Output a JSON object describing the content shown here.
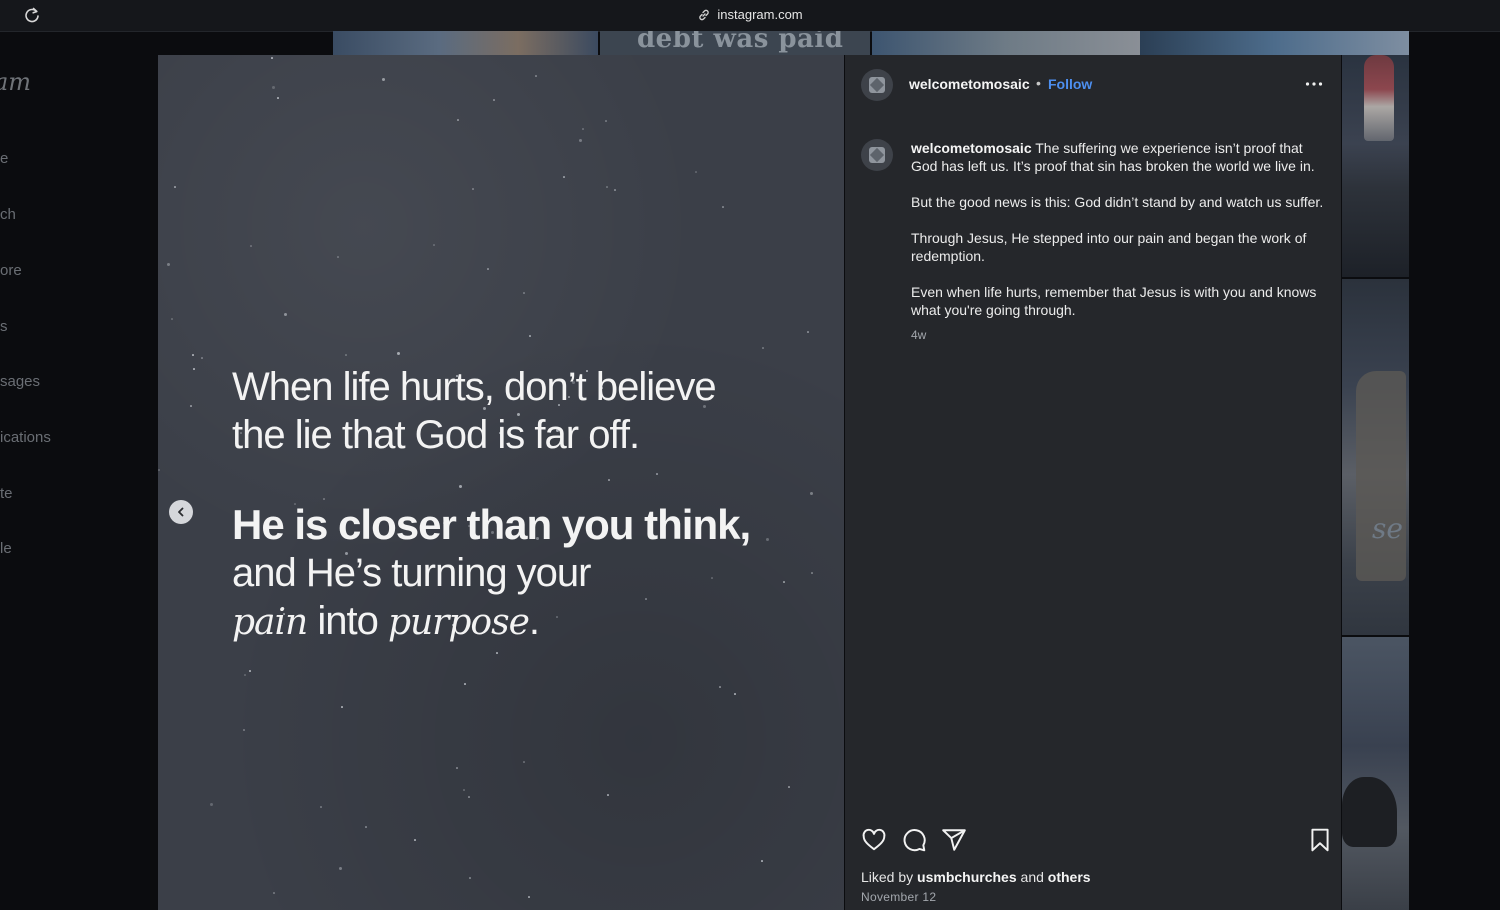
{
  "browser": {
    "url": "instagram.com"
  },
  "background_page": {
    "logo_fragment": "am",
    "nav_fragments": [
      "e",
      "ch",
      "ore",
      "s",
      "sages",
      "ications",
      "te",
      "le"
    ],
    "tile_text": "debt was paid",
    "tile_text_right": "se"
  },
  "post": {
    "image_text": {
      "line1": "When life hurts, don’t believe",
      "line2": "the lie that God is far off.",
      "line3": "He is closer than you think,",
      "line4": "and He’s turning your",
      "line5_a": "pain",
      "line5_b": " into ",
      "line5_c": "purpose",
      "line5_d": "."
    },
    "author": "welcometomosaic",
    "separator": "•",
    "follow_label": "Follow",
    "caption": {
      "author": "welcometomosaic",
      "paragraphs": [
        "The suffering we experience isn’t proof that God has left us. It’s proof that sin has broken the world we live in.",
        "But the good news is this: God didn’t stand by and watch us suffer.",
        "Through Jesus, He stepped into our pain and began the work of redemption.",
        "Even when life hurts, remember that Jesus is with you and knows what you're going through."
      ],
      "time": "4w"
    },
    "likes": {
      "prefix": "Liked by ",
      "user": "usmbchurches",
      "middle": " and ",
      "others": "others"
    },
    "date": "November 12",
    "icons": {
      "like": "heart-icon",
      "comment": "comment-icon",
      "share": "send-icon",
      "save": "bookmark-icon",
      "more": "more-icon",
      "prev": "chevron-left-icon"
    }
  }
}
